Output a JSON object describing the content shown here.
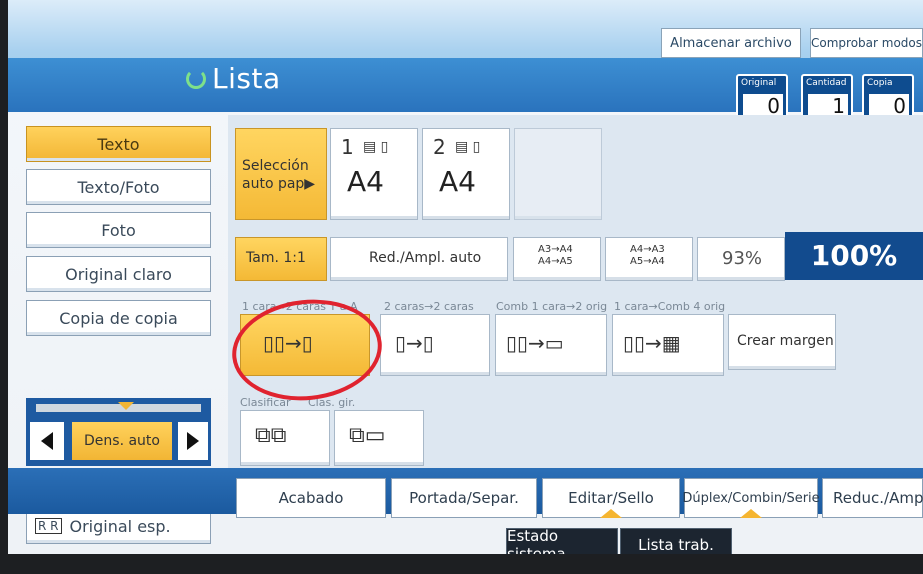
{
  "header": {
    "status": "Lista",
    "store_file": "Almacenar archivo",
    "check_modes": "Comprobar modos",
    "counters": [
      {
        "label": "Original",
        "value": "0"
      },
      {
        "label": "Cantidad",
        "value": "1"
      },
      {
        "label": "Copia",
        "value": "0"
      }
    ]
  },
  "modes": [
    "Texto",
    "Texto/Foto",
    "Foto",
    "Original claro",
    "Copia de copia"
  ],
  "paper": {
    "auto_select": "Selección auto pap▶",
    "tray1_num": "1",
    "tray1_size": "A4",
    "tray2_num": "2",
    "tray2_size": "A4"
  },
  "ratio": {
    "full_size": "Tam. 1:1",
    "auto_reduce": "Red./Ampl. auto",
    "a3_a4": "A3→A4",
    "a4_a5": "A4→A5",
    "a4_a3": "A4→A3",
    "a5_a4": "A5→A4",
    "preset": "93%",
    "current": "100%"
  },
  "duplex": {
    "label_1": "1 cara→2 caras T a A",
    "label_2": "2 caras→2 caras",
    "label_3": "Comb 1 cara→2 orig",
    "label_4": "1 cara→Comb 4 orig",
    "margin": "Crear margen"
  },
  "sort": {
    "label_1": "Clasificar",
    "label_2": "Clas. gir."
  },
  "density": {
    "label": "Dens. auto"
  },
  "special_original": "Original esp.",
  "bottom_tabs": [
    "Acabado",
    "Portada/Separ.",
    "Editar/Sello",
    "Dúplex/Combin/Serie",
    "Reduc./Ampl"
  ],
  "status_buttons": [
    "Estado sistema",
    "Lista trab."
  ]
}
